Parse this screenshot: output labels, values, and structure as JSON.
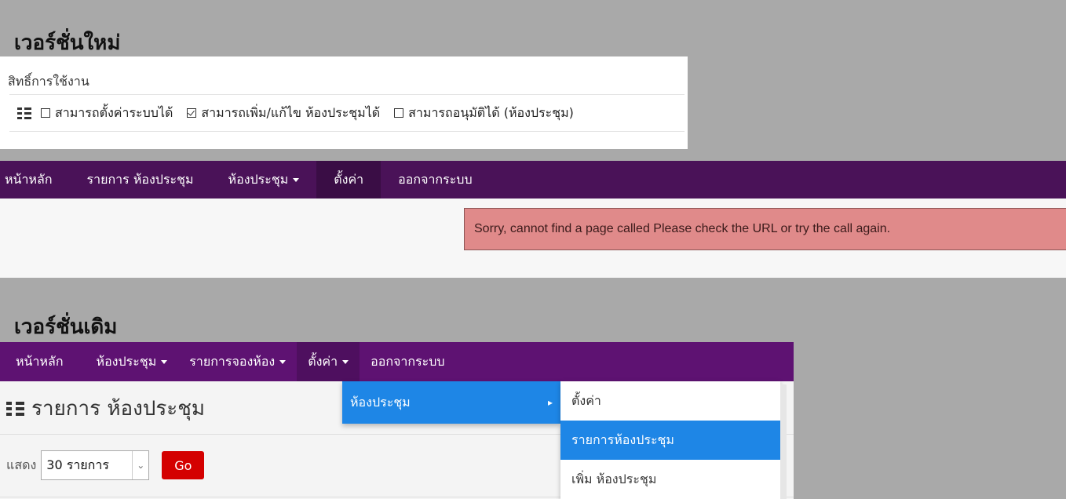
{
  "sections": {
    "new_title": "เวอร์ชั่นใหม่",
    "old_title": "เวอร์ชั่นเดิม"
  },
  "permissions": {
    "label": "สิทธิ์การใช้งาน",
    "items": [
      {
        "label": "สามารถตั้งค่าระบบได้",
        "checked": false
      },
      {
        "label": "สามารถเพิ่ม/แก้ไข ห้องประชุมได้",
        "checked": true
      },
      {
        "label": "สามารถอนุมัติได้ (ห้องประชุม)",
        "checked": false
      }
    ]
  },
  "new_nav": {
    "items": [
      "หน้าหลัก",
      "รายการ ห้องประชุม",
      "ห้องประชุม",
      "ตั้งค่า",
      "ออกจากระบบ"
    ],
    "bg_color": "#4a1258"
  },
  "error": {
    "message": "Sorry, cannot find a page called Please check the URL or try the call again.",
    "color": "#e08a8a"
  },
  "old_nav": {
    "items": [
      "หน้าหลัก",
      "ห้องประชุม",
      "รายการจองห้อง",
      "ตั้งค่า",
      "ออกจากระบบ"
    ],
    "bg_color": "#5e1272"
  },
  "old_page": {
    "heading": "รายการ ห้องประชุม",
    "show_label": "แสดง",
    "show_value": "30 รายการ",
    "go_label": "Go"
  },
  "dropdown": {
    "main_item": "ห้องประชุม",
    "sub_items": [
      "ตั้งค่า",
      "รายการห้องประชุม",
      "เพิ่ม ห้องประชุม"
    ],
    "highlight_color": "#1e86e6"
  }
}
